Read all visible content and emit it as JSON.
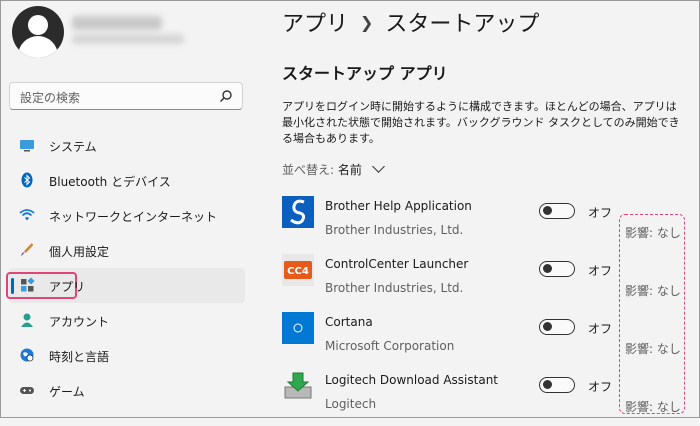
{
  "sidebar": {
    "search_placeholder": "設定の検索",
    "items": [
      {
        "label": "システム",
        "icon": "monitor-icon"
      },
      {
        "label": "Bluetooth とデバイス",
        "icon": "bluetooth-icon"
      },
      {
        "label": "ネットワークとインターネット",
        "icon": "wifi-icon"
      },
      {
        "label": "個人用設定",
        "icon": "brush-icon"
      },
      {
        "label": "アプリ",
        "icon": "apps-icon",
        "active": true
      },
      {
        "label": "アカウント",
        "icon": "person-icon"
      },
      {
        "label": "時刻と言語",
        "icon": "globe-clock-icon"
      },
      {
        "label": "ゲーム",
        "icon": "gamepad-icon"
      }
    ]
  },
  "main": {
    "breadcrumb": [
      "アプリ",
      "スタートアップ"
    ],
    "section_title": "スタートアップ アプリ",
    "description": "アプリをログイン時に開始するように構成できます。ほとんどの場合、アプリは最小化された状態で開始されます。バックグラウンド タスクとしてのみ開始できる場合もあります。",
    "sort_label": "並べ替え:",
    "sort_value": "名前",
    "apps": [
      {
        "name": "Brother Help Application",
        "publisher": "Brother Industries, Ltd.",
        "state": "オフ",
        "impact": "影響: なし",
        "icon": "brother-help-icon"
      },
      {
        "name": "ControlCenter Launcher",
        "publisher": "Brother Industries, Ltd.",
        "state": "オフ",
        "impact": "影響: なし",
        "icon": "controlcenter-icon"
      },
      {
        "name": "Cortana",
        "publisher": "Microsoft Corporation",
        "state": "オフ",
        "impact": "影響: なし",
        "icon": "cortana-icon"
      },
      {
        "name": "Logitech Download Assistant",
        "publisher": "Logitech",
        "state": "オフ",
        "impact": "影響: なし",
        "icon": "logitech-download-icon"
      }
    ]
  },
  "colors": {
    "accent": "#0067c0",
    "highlight": "#e0457a",
    "background": "#f3f3f3"
  }
}
